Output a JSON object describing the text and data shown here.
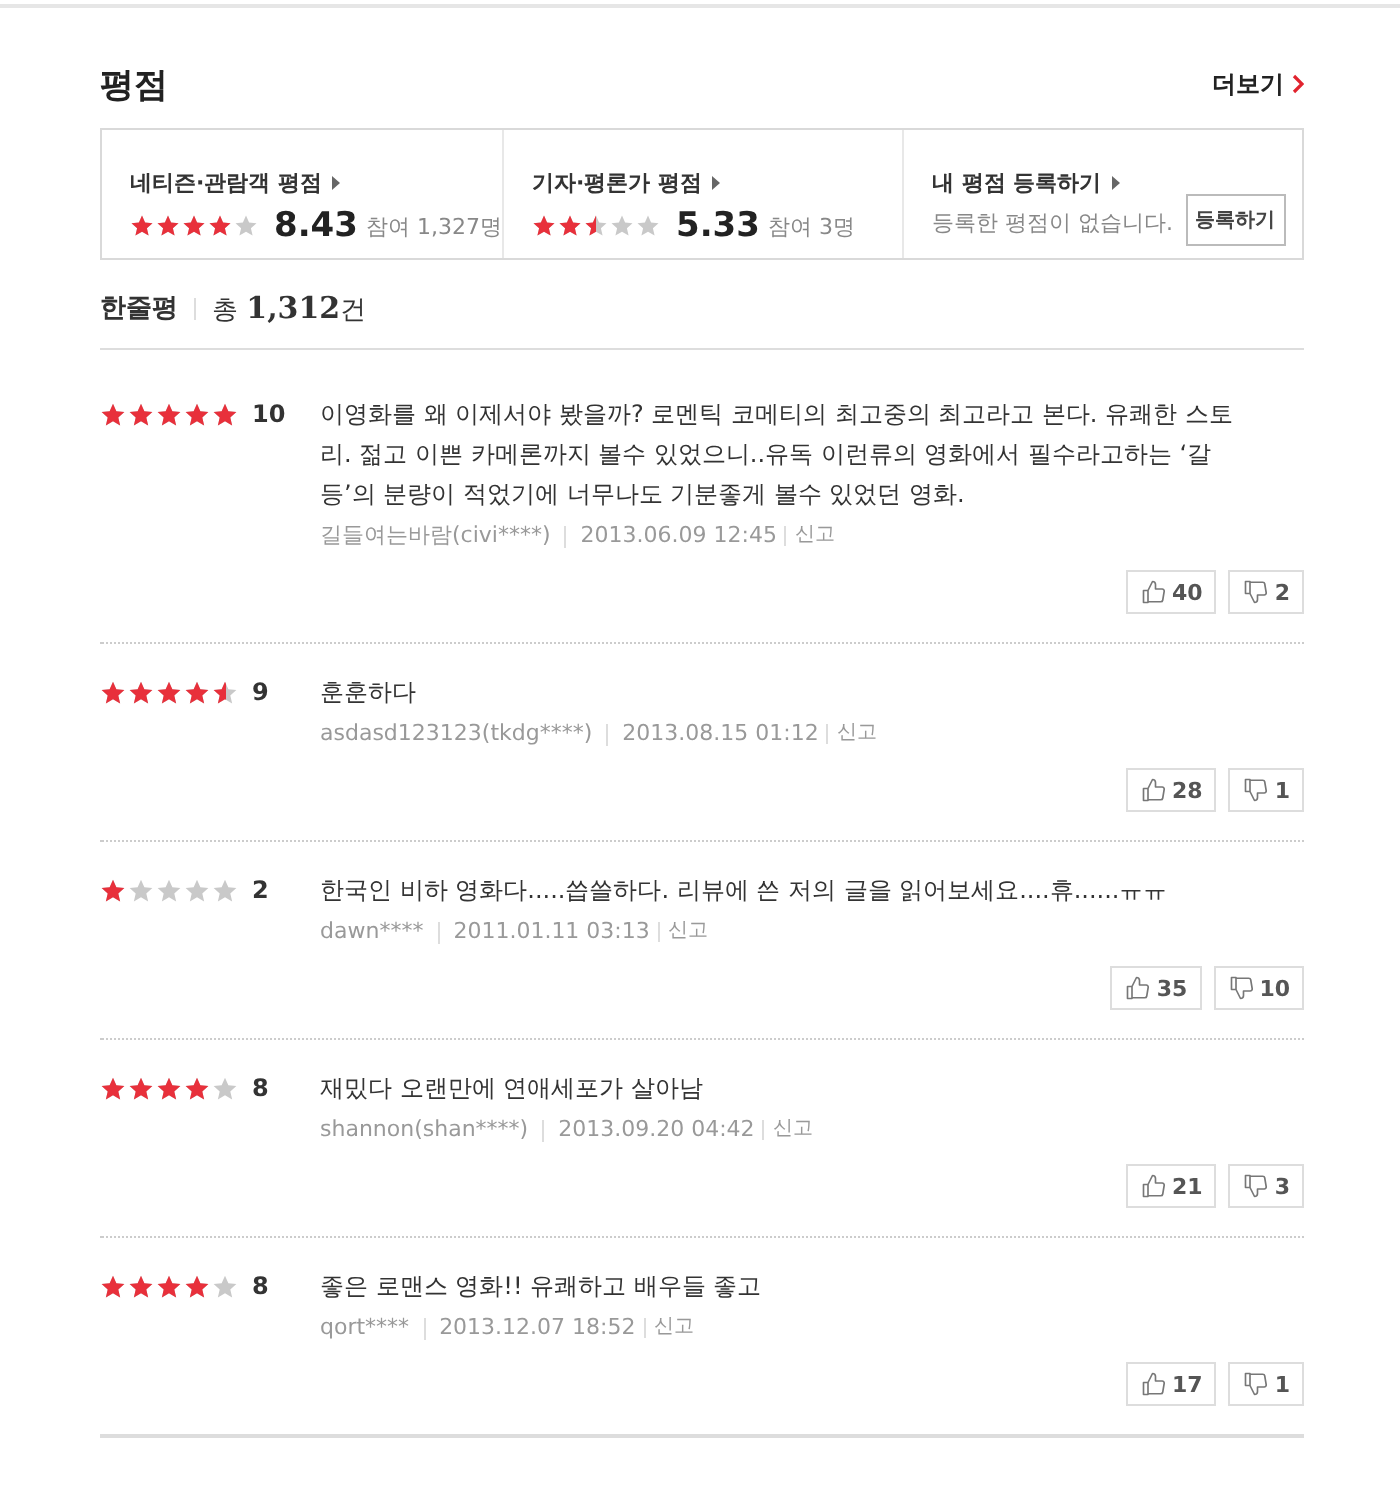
{
  "section": {
    "title": "평점",
    "more_link": "더보기"
  },
  "summary": [
    {
      "kind": "rating",
      "label": "네티즌·관람객 평점",
      "stars": 4,
      "score": "8.43",
      "participants": "참여 1,327명"
    },
    {
      "kind": "rating",
      "label": "기자·평론가 평점",
      "stars": 2.5,
      "score": "5.33",
      "participants": "참여 3명"
    },
    {
      "kind": "register",
      "label": "내 평점 등록하기",
      "message": "등록한 평점이 없습니다.",
      "button": "등록하기"
    }
  ],
  "reviews_header": {
    "title": "한줄평",
    "total": "총 **1,312**건"
  },
  "reviews": [
    {
      "stars": 5,
      "score": "10",
      "text": "이영화를 왜 이제서야 봤을까? 로멘틱 코메티의 최고중의 최고라고 본다. 유쾌한 스토리. 젊고 이쁜 카메론까지 볼수 있었으니..유독 이런류의 영화에서 필수라고하는 ‘갈등’의 분량이 적었기에 너무나도 기분좋게 볼수 있었던 영화.",
      "author": "길들여는바람(civi****)",
      "date": "2013.06.09 12:45",
      "report": "신고",
      "likes": "40",
      "dislikes": "2"
    },
    {
      "stars": 4.5,
      "score": "9",
      "text": "훈훈하다",
      "author": "asdasd123123(tkdg****)",
      "date": "2013.08.15 01:12",
      "report": "신고",
      "likes": "28",
      "dislikes": "1"
    },
    {
      "stars": 1,
      "score": "2",
      "text": "한국인 비하 영화다.....씁쓸하다. 리뷰에 쓴 저의 글을 읽어보세요....휴......ㅠㅠ",
      "author": "dawn****",
      "date": "2011.01.11 03:13",
      "report": "신고",
      "likes": "35",
      "dislikes": "10"
    },
    {
      "stars": 4,
      "score": "8",
      "text": "재밌다 오랜만에 연애세포가 살아남",
      "author": "shannon(shan****)",
      "date": "2013.09.20 04:42",
      "report": "신고",
      "likes": "21",
      "dislikes": "3"
    },
    {
      "stars": 4,
      "score": "8",
      "text": "좋은 로맨스 영화!! 유쾌하고 배우들 좋고",
      "author": "qort****",
      "date": "2013.12.07 18:52",
      "report": "신고",
      "likes": "17",
      "dislikes": "1"
    }
  ]
}
